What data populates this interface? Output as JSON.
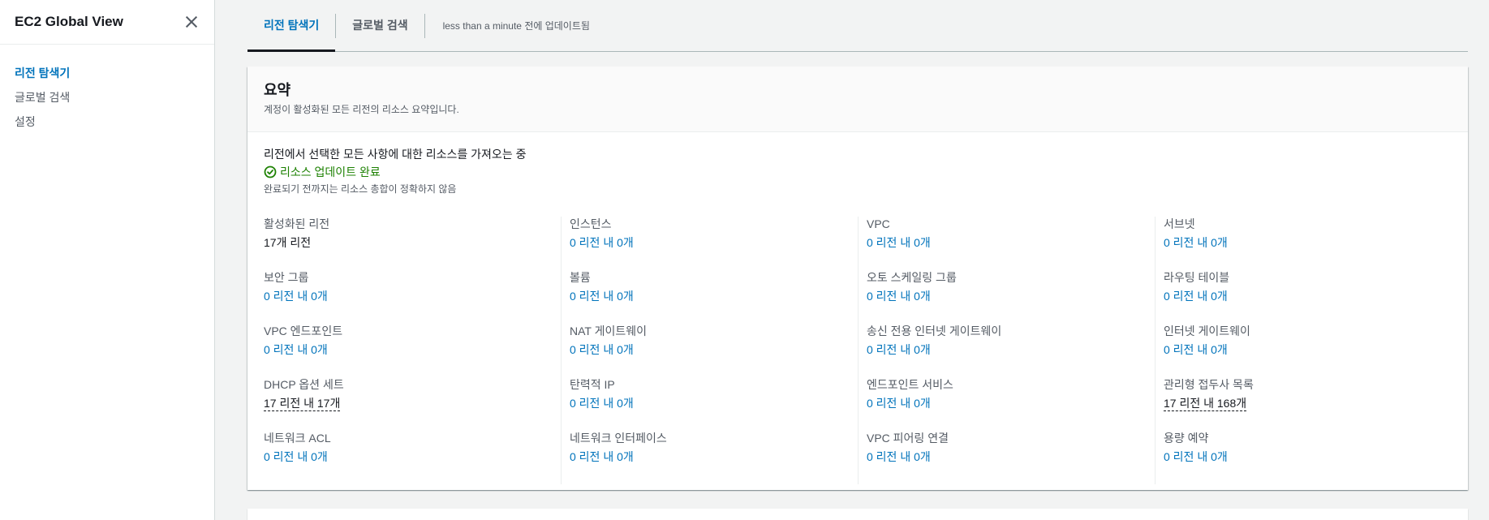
{
  "sidebar": {
    "title": "EC2 Global View",
    "items": [
      {
        "label": "리전 탐색기",
        "active": true
      },
      {
        "label": "글로벌 검색",
        "active": false
      },
      {
        "label": "설정",
        "active": false
      }
    ]
  },
  "tabs": {
    "region_explorer": "리전 탐색기",
    "global_search": "글로벌 검색",
    "updated": "less than a minute 전에 업데이트됨"
  },
  "summary": {
    "title": "요약",
    "description": "계정이 활성화된 모든 리전의 리소스 요약입니다.",
    "loading_text": "리전에서 선택한 모든 사항에 대한 리소스를 가져오는 중",
    "success_text": "리소스 업데이트 완료",
    "note": "완료되기 전까지는 리소스 총합이 정확하지 않음"
  },
  "resources": {
    "col1": [
      {
        "label": "활성화된 리전",
        "value": "17개 리전"
      },
      {
        "label": "보안 그룹",
        "value": "0 리전 내 0개"
      },
      {
        "label": "VPC 엔드포인트",
        "value": "0 리전 내 0개"
      },
      {
        "label": "DHCP 옵션 세트",
        "value": "17 리전 내 17개"
      },
      {
        "label": "네트워크 ACL",
        "value": "0 리전 내 0개"
      }
    ],
    "col2": [
      {
        "label": "인스턴스",
        "value": "0 리전 내 0개"
      },
      {
        "label": "볼륨",
        "value": "0 리전 내 0개"
      },
      {
        "label": "NAT 게이트웨이",
        "value": "0 리전 내 0개"
      },
      {
        "label": "탄력적 IP",
        "value": "0 리전 내 0개"
      },
      {
        "label": "네트워크 인터페이스",
        "value": "0 리전 내 0개"
      }
    ],
    "col3": [
      {
        "label": "VPC",
        "value": "0 리전 내 0개"
      },
      {
        "label": "오토 스케일링 그룹",
        "value": "0 리전 내 0개"
      },
      {
        "label": "송신 전용 인터넷 게이트웨이",
        "value": "0 리전 내 0개"
      },
      {
        "label": "엔드포인트 서비스",
        "value": "0 리전 내 0개"
      },
      {
        "label": "VPC 피어링 연결",
        "value": "0 리전 내 0개"
      }
    ],
    "col4": [
      {
        "label": "서브넷",
        "value": "0 리전 내 0개"
      },
      {
        "label": "라우팅 테이블",
        "value": "0 리전 내 0개"
      },
      {
        "label": "인터넷 게이트웨이",
        "value": "0 리전 내 0개"
      },
      {
        "label": "관리형 접두사 목록",
        "value": "17 리전 내 168개"
      },
      {
        "label": "용량 예약",
        "value": "0 리전 내 0개"
      }
    ]
  },
  "colors": {
    "link": "#0073bb",
    "success": "#1d8102",
    "text": "#16191f",
    "muted": "#545b64"
  }
}
